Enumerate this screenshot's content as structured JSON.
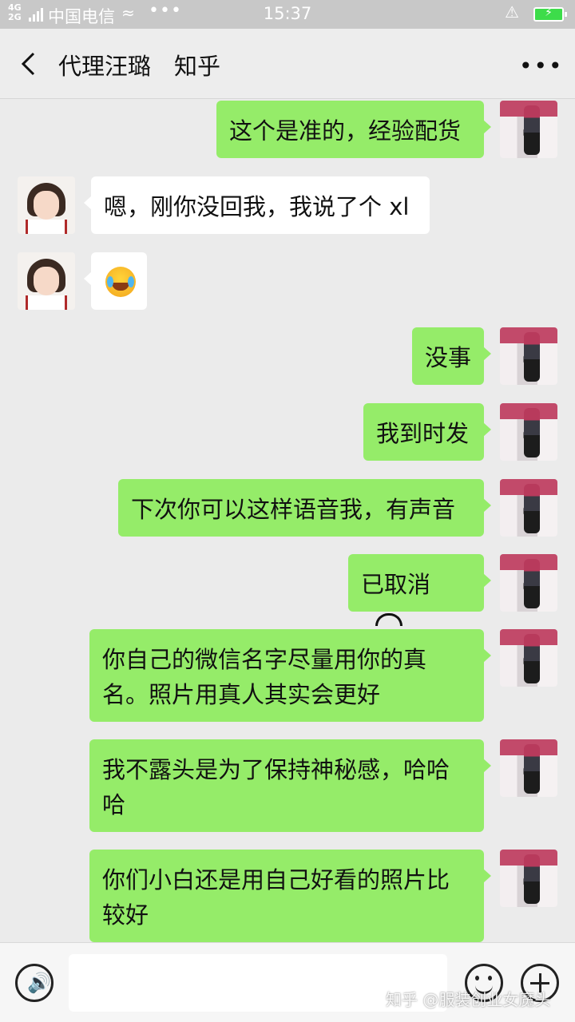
{
  "status_bar": {
    "network": "4G\n2G",
    "carrier": "中国电信",
    "wifi_icon": "wifi-icon",
    "more": "•••",
    "time": "15:37",
    "mute_icon": "bell-off-icon",
    "battery_icon": "battery-charging-icon"
  },
  "header": {
    "back_icon": "chevron-left-icon",
    "title": "代理汪璐　知乎",
    "more_icon": "more-dots-icon",
    "more_label": "•••"
  },
  "messages": [
    {
      "from": "me",
      "text": "这个是准的，经验配货"
    },
    {
      "from": "them",
      "text": "嗯，刚你没回我，我说了个 xl"
    },
    {
      "from": "them",
      "type": "emoji",
      "emoji": "crying-laughing-face"
    },
    {
      "from": "me",
      "text": "没事"
    },
    {
      "from": "me",
      "text": "我到时发"
    },
    {
      "from": "me",
      "text": "下次你可以这样语音我，有声音"
    },
    {
      "from": "me",
      "text": "已取消",
      "icon": "hang-up-phone-icon"
    },
    {
      "from": "me",
      "text": "你自己的微信名字尽量用你的真名。照片用真人其实会更好"
    },
    {
      "from": "me",
      "text": "我不露头是为了保持神秘感，哈哈哈"
    },
    {
      "from": "me",
      "text": "你们小白还是用自己好看的照片比较好"
    }
  ],
  "input_bar": {
    "voice_icon": "voice-icon",
    "voice_glyph": "🔊",
    "text_value": "",
    "emoji_icon": "emoji-icon",
    "add_icon": "plus-icon"
  },
  "watermark": "知乎 @服装创业女魔头"
}
